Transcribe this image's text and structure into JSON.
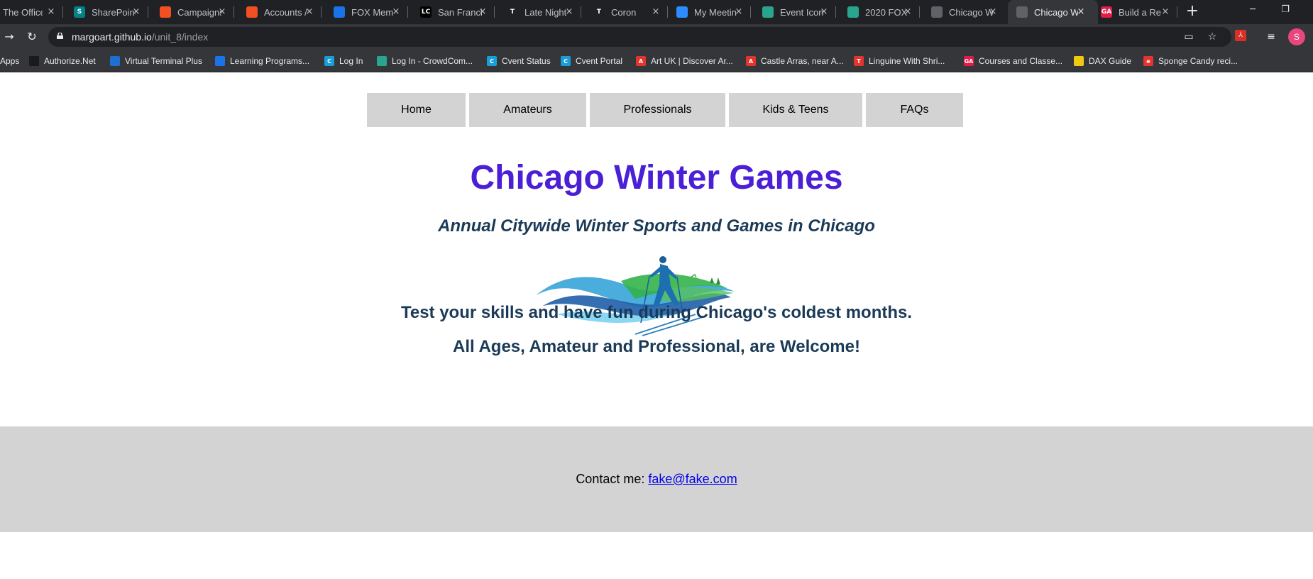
{
  "browser": {
    "tabs": [
      {
        "title": "The Office",
        "favicon": "office-icon",
        "color": "#555"
      },
      {
        "title": "SharePoint",
        "favicon": "sharepoint-icon",
        "color": "#038387",
        "glyph": "S"
      },
      {
        "title": "Campaigns",
        "favicon": "microsoft-icon",
        "color": "#f25022"
      },
      {
        "title": "Accounts /",
        "favicon": "microsoft-icon",
        "color": "#f25022"
      },
      {
        "title": "FOX Mem",
        "favicon": "fox-icon",
        "color": "#1a73e8"
      },
      {
        "title": "San Franci",
        "favicon": "lc-icon",
        "color": "#000",
        "glyph": "LC"
      },
      {
        "title": "Late Night",
        "favicon": "nyt-icon",
        "color": "#202124",
        "glyph": "T"
      },
      {
        "title": "Coron",
        "favicon": "nyt-icon",
        "color": "#202124",
        "glyph": "T"
      },
      {
        "title": "My Meetin",
        "favicon": "zoom-icon",
        "color": "#2d8cff"
      },
      {
        "title": "Event Icon",
        "favicon": "crowdcompass-icon",
        "color": "#29a58f"
      },
      {
        "title": "2020 FOX",
        "favicon": "crowdcompass-icon",
        "color": "#29a58f"
      },
      {
        "title": "Chicago W",
        "favicon": "globe-icon",
        "color": "#5f6368"
      },
      {
        "title": "Chicago W",
        "favicon": "globe-icon",
        "color": "#5f6368"
      },
      {
        "title": "Build a Re",
        "favicon": "ga-icon",
        "color": "#e21b48",
        "glyph": "GA"
      }
    ],
    "tab_close_glyph": "×",
    "new_tab_glyph": "+",
    "window_controls": {
      "minimize": "─",
      "restore": "❐"
    },
    "url_host": "margoart.github.io",
    "url_path": "/unit_8/index",
    "avatar_letter": "S",
    "bookmarks": [
      {
        "label": "Apps",
        "favicon": "apps-grid-icon",
        "color": ""
      },
      {
        "label": "Authorize.Net",
        "favicon": "authorize-icon",
        "color": "#1a1a1a"
      },
      {
        "label": "Virtual Terminal Plus",
        "favicon": "vt-icon",
        "color": "#1f6fd1"
      },
      {
        "label": "Learning Programs...",
        "favicon": "fox-icon",
        "color": "#1a73e8"
      },
      {
        "label": "Log In",
        "favicon": "cvent-icon",
        "color": "#1a9ed9",
        "glyph": "C"
      },
      {
        "label": "Log In - CrowdCom...",
        "favicon": "crowdcompass-icon",
        "color": "#29a58f"
      },
      {
        "label": "Cvent Status",
        "favicon": "cvent-icon",
        "color": "#1a9ed9",
        "glyph": "C"
      },
      {
        "label": "Cvent Portal",
        "favicon": "cvent-icon",
        "color": "#1a9ed9",
        "glyph": "C"
      },
      {
        "label": "Art UK | Discover Ar...",
        "favicon": "artuk-icon",
        "color": "#e3342f",
        "glyph": "A"
      },
      {
        "label": "Castle Arras, near A...",
        "favicon": "artuk-icon",
        "color": "#e3342f",
        "glyph": "A"
      },
      {
        "label": "Linguine With Shri...",
        "favicon": "nyt-cooking-icon",
        "color": "#e3342f",
        "glyph": "T"
      },
      {
        "label": "Courses and Classe...",
        "favicon": "ga-icon",
        "color": "#e21b48",
        "glyph": "GA"
      },
      {
        "label": "DAX Guide",
        "favicon": "dax-icon",
        "color": "#f2c811"
      },
      {
        "label": "Sponge Candy reci...",
        "favicon": "recipe-icon",
        "color": "#e3342f",
        "glyph": "e"
      }
    ]
  },
  "site": {
    "nav": [
      "Home",
      "Amateurs",
      "Professionals",
      "Kids & Teens",
      "FAQs"
    ],
    "title": "Chicago Winter Games",
    "subtitle": "Annual Citywide Winter Sports and Games in Chicago",
    "tagline_1": "Test your skills and have fun during Chicago's coldest months.",
    "tagline_2": "All Ages, Amateur and Professional, are Welcome!",
    "footer_label": "Contact me: ",
    "footer_email": "fake@fake.com",
    "colors": {
      "title": "#4b1fd6",
      "text": "#1b3a57",
      "nav_bg": "#d3d3d3",
      "footer_bg": "#d3d3d3",
      "link": "#0000ee"
    }
  }
}
